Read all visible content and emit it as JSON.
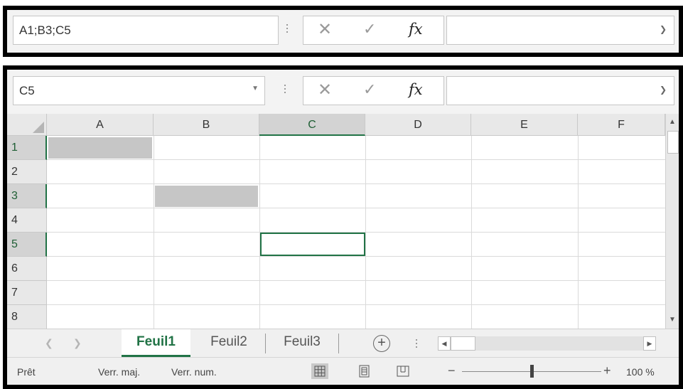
{
  "top_bar": {
    "namebox_value": "A1;B3;C5",
    "function_glyph": "fx",
    "cancel_glyph": "✕",
    "enter_glyph": "✓"
  },
  "bottom_bar": {
    "namebox_value": "C5",
    "function_glyph": "fx",
    "cancel_glyph": "✕",
    "enter_glyph": "✓"
  },
  "grid": {
    "columns": [
      "A",
      "B",
      "C",
      "D",
      "E",
      "F"
    ],
    "rows": [
      "1",
      "2",
      "3",
      "4",
      "5",
      "6",
      "7",
      "8"
    ],
    "selected_cells": [
      "A1",
      "B3",
      "C5"
    ],
    "active_cell": "C5"
  },
  "sheet_tabs": [
    {
      "label": "Feuil1",
      "active": true
    },
    {
      "label": "Feuil2",
      "active": false
    },
    {
      "label": "Feuil3",
      "active": false
    }
  ],
  "add_sheet_glyph": "+",
  "status_bar": {
    "ready": "Prêt",
    "caps_lock": "Verr. maj.",
    "num_lock": "Verr. num.",
    "zoom_minus": "−",
    "zoom_plus": "+",
    "zoom_level": "100 %",
    "zoom_fraction": 0.5
  },
  "icons": {
    "normal_view": "grid-view-icon",
    "page_layout_view": "page-layout-icon",
    "page_break_view": "page-break-icon"
  },
  "colors": {
    "accent": "#217346",
    "selection": "#c6c6c6"
  }
}
